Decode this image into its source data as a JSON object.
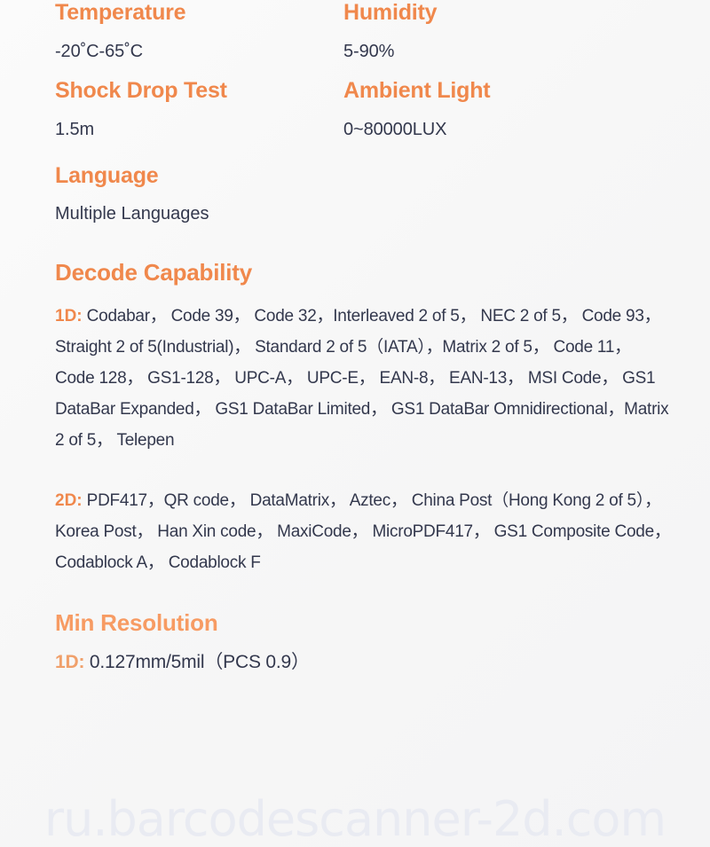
{
  "specs": [
    {
      "title": "Temperature",
      "value": "-20˚C-65˚C"
    },
    {
      "title": "Humidity",
      "value": "5-90%"
    },
    {
      "title": "Shock Drop Test",
      "value": "1.5m"
    },
    {
      "title": "Ambient Light",
      "value": "0~80000LUX"
    }
  ],
  "language": {
    "title": "Language",
    "value": "Multiple Languages"
  },
  "decode": {
    "title": "Decode Capability",
    "oned": {
      "label": "1D:",
      "list": "Codabar， Code 39， Code 32，Interleaved 2 of 5， NEC 2 of 5， Code 93， Straight 2 of 5(Industrial)， Standard 2 of 5（IATA），Matrix 2 of 5， Code 11， Code 128， GS1-128， UPC-A， UPC-E， EAN-8， EAN-13， MSI Code， GS1 DataBar Expanded， GS1 DataBar Limited， GS1 DataBar Omnidirectional，Matrix 2 of 5， Telepen"
    },
    "twod": {
      "label": "2D:",
      "list": "PDF417，QR code， DataMatrix， Aztec， China Post（Hong Kong 2 of 5），Korea Post， Han Xin code， MaxiCode， MicroPDF417， GS1 Composite Code，Codablock A， Codablock F"
    }
  },
  "min_resolution": {
    "title": "Min Resolution",
    "oned": {
      "label": "1D:",
      "value": "0.127mm/5mil（PCS 0.9）"
    }
  },
  "watermark": "ru.barcodescanner-2d.com",
  "colors": {
    "accent": "#f0884c",
    "accent_light": "#f79b63",
    "text": "#33384d",
    "background": "#f7f7f7",
    "watermark": "#e9ebf2"
  }
}
